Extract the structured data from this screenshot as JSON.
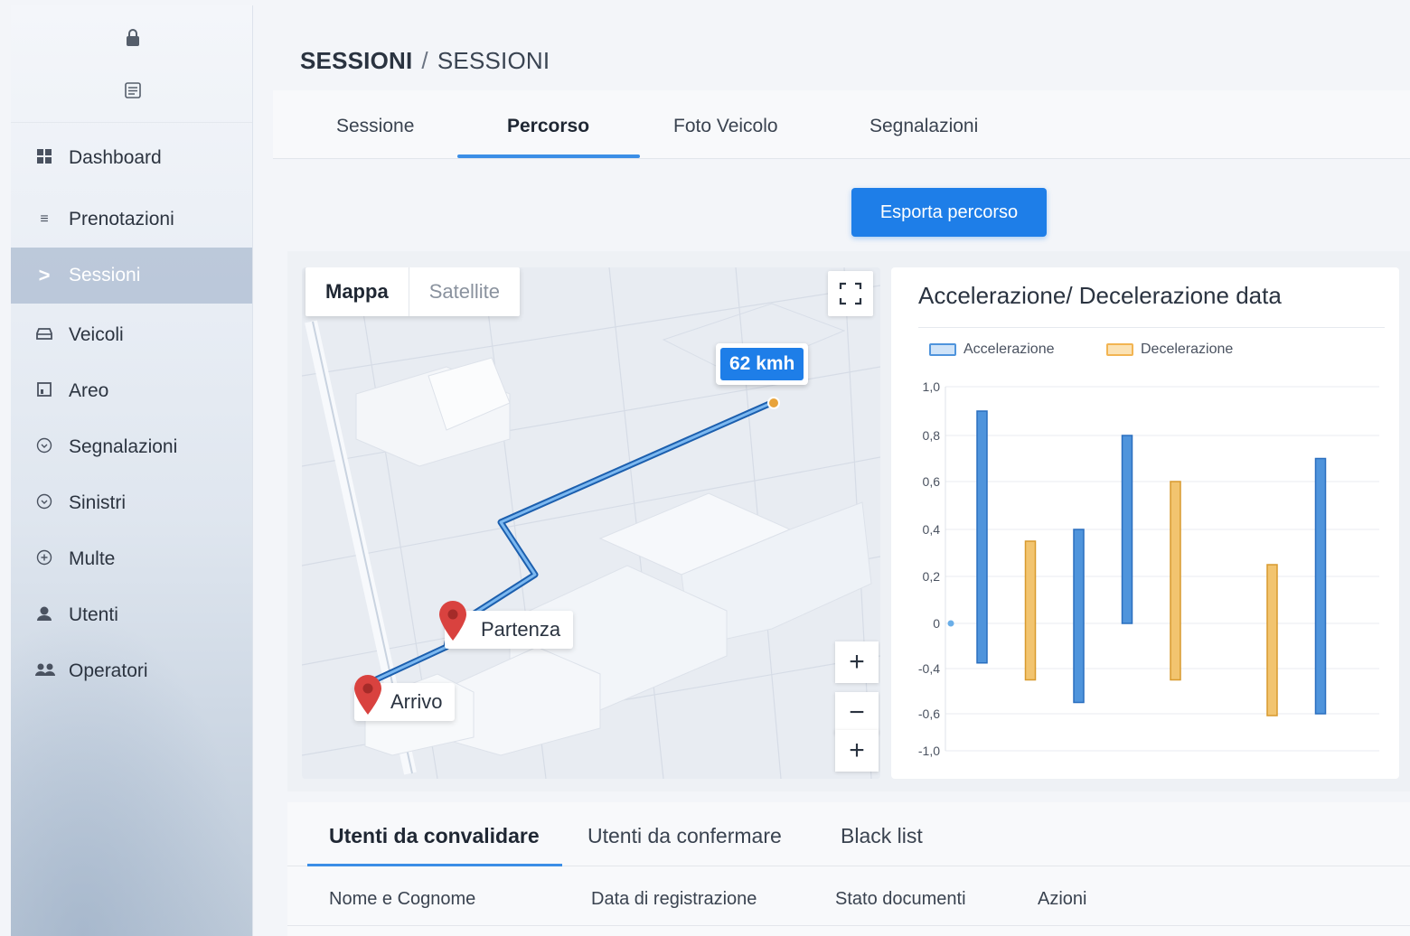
{
  "breadcrumb": {
    "section": "SESSIONI",
    "separator": "/",
    "page": "SESSIONI"
  },
  "sidebar": {
    "top_icons": [
      "lock-icon",
      "list-icon"
    ],
    "items": [
      {
        "label": "Dashboard",
        "icon": "grid-icon"
      },
      {
        "label": "Prenotazioni",
        "icon": "menu-icon"
      },
      {
        "label": "Sessioni",
        "icon": "chevron-right-icon",
        "active": true
      },
      {
        "label": "Veicoli",
        "icon": "car-icon"
      },
      {
        "label": "Areo",
        "icon": "building-icon"
      },
      {
        "label": "Segnalazioni",
        "icon": "circle-check-icon"
      },
      {
        "label": "Sinistri",
        "icon": "circle-check-icon"
      },
      {
        "label": "Multe",
        "icon": "circle-plus-icon"
      },
      {
        "label": "Utenti",
        "icon": "user-icon"
      },
      {
        "label": "Operatori",
        "icon": "users-icon"
      }
    ]
  },
  "tabs": [
    {
      "label": "Sessione"
    },
    {
      "label": "Percorso",
      "active": true
    },
    {
      "label": "Foto Veicolo"
    },
    {
      "label": "Segnalazioni"
    }
  ],
  "export_button": "Esporta percorso",
  "map": {
    "toggle": {
      "map": "Mappa",
      "satellite": "Satellite"
    },
    "speed": "62 kmh",
    "start_label": "Partenza",
    "end_label": "Arrivo",
    "zoom_in": "+",
    "zoom_out": "−",
    "zoom_extra": "+"
  },
  "colors": {
    "accent": "#1e7ee8",
    "accel": "#4f94dc",
    "decel": "#f2c46f"
  },
  "chart_data": {
    "type": "bar",
    "title": "Accelerazione/ Decelerazione data",
    "legend": [
      "Accelerazione",
      "Decelerazione"
    ],
    "yticks": [
      "1,0",
      "0,8",
      "0,6",
      "0,4",
      "0,2",
      "0",
      "-0,4",
      "-0,6",
      "-1,0"
    ],
    "series": [
      {
        "name": "Accelerazione",
        "bars": [
          {
            "x": 1,
            "low": -0.35,
            "high": 0.9
          },
          {
            "x": 3,
            "low": -0.55,
            "high": 0.4
          },
          {
            "x": 4,
            "low": 0.0,
            "high": 0.8
          },
          {
            "x": 8,
            "low": -0.6,
            "high": 0.7
          }
        ]
      },
      {
        "name": "Decelerazione",
        "bars": [
          {
            "x": 2,
            "low": -0.45,
            "high": 0.35
          },
          {
            "x": 5,
            "low": -0.45,
            "high": 0.6
          },
          {
            "x": 7,
            "low": -0.62,
            "high": 0.25
          }
        ]
      }
    ]
  },
  "bottom_tabs": [
    {
      "label": "Utenti da convalidare",
      "active": true
    },
    {
      "label": "Utenti da confermare"
    },
    {
      "label": "Black list"
    }
  ],
  "table_headers": [
    "Nome e Cognome",
    "Data di registrazione",
    "Stato documenti",
    "Azioni"
  ]
}
